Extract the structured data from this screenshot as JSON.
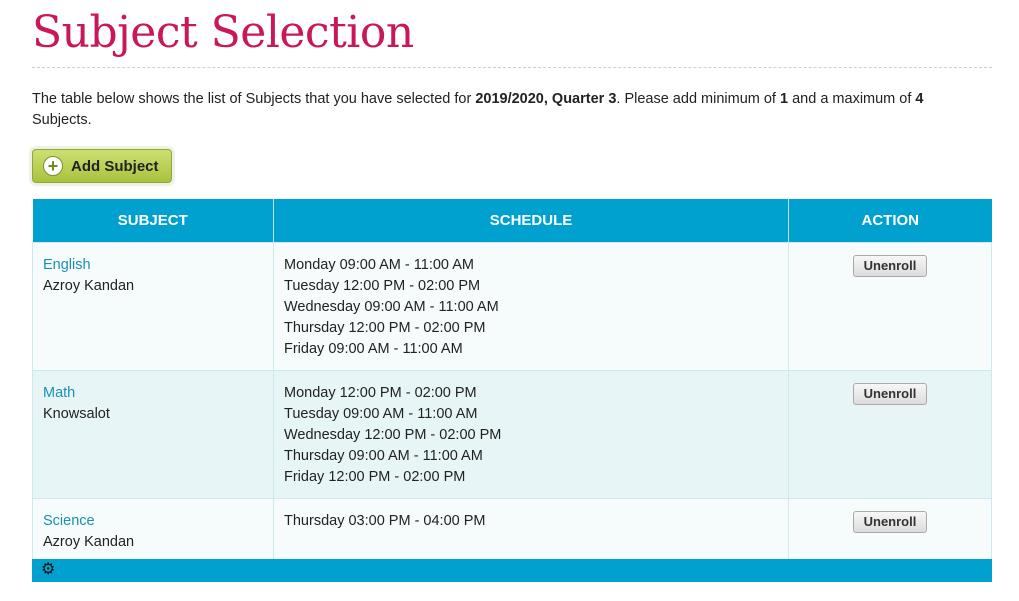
{
  "page": {
    "title": "Subject Selection",
    "intro": {
      "part1": "The table below shows the list of Subjects that you have selected for ",
      "term": "2019/2020, Quarter 3",
      "part2": ". Please add minimum of ",
      "min": "1",
      "part3": " and a maximum of ",
      "max": "4",
      "part4": " Subjects."
    },
    "add_button_label": "Add Subject"
  },
  "table": {
    "headers": [
      "SUBJECT",
      "SCHEDULE",
      "ACTION"
    ],
    "rows": [
      {
        "subject": "English",
        "teacher": "Azroy Kandan",
        "schedule": [
          "Monday 09:00 AM - 11:00 AM",
          "Tuesday 12:00 PM - 02:00 PM",
          "Wednesday 09:00 AM - 11:00 AM",
          "Thursday 12:00 PM - 02:00 PM",
          "Friday 09:00 AM - 11:00 AM"
        ],
        "action": "Unenroll"
      },
      {
        "subject": "Math",
        "teacher": "Knowsalot",
        "schedule": [
          "Monday 12:00 PM - 02:00 PM",
          "Tuesday 09:00 AM - 11:00 AM",
          "Wednesday 12:00 PM - 02:00 PM",
          "Thursday 09:00 AM - 11:00 AM",
          "Friday 12:00 PM - 02:00 PM"
        ],
        "action": "Unenroll"
      },
      {
        "subject": "Science",
        "teacher": "Azroy Kandan",
        "schedule": [
          "Thursday 03:00 PM - 04:00 PM"
        ],
        "action": "Unenroll"
      }
    ]
  },
  "icons": {
    "add": "plus-circle-icon",
    "footer": "gear-icon"
  },
  "colors": {
    "title": "#c8185a",
    "header": "#00a0cf",
    "link": "#1b8fb5",
    "add_button": "#b5cd4f"
  }
}
